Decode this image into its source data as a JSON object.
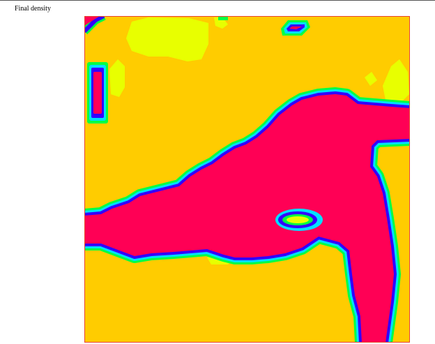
{
  "figure": {
    "title": "Final density"
  },
  "density_map": {
    "palette": {
      "background": "#ffcc00",
      "high_density": "#ff0055",
      "low_density": "#e8ff00",
      "band_blue": "#3300ff",
      "band_cyan": "#00e0ff",
      "band_green": "#00ff44",
      "frame": "#e8432a"
    }
  }
}
